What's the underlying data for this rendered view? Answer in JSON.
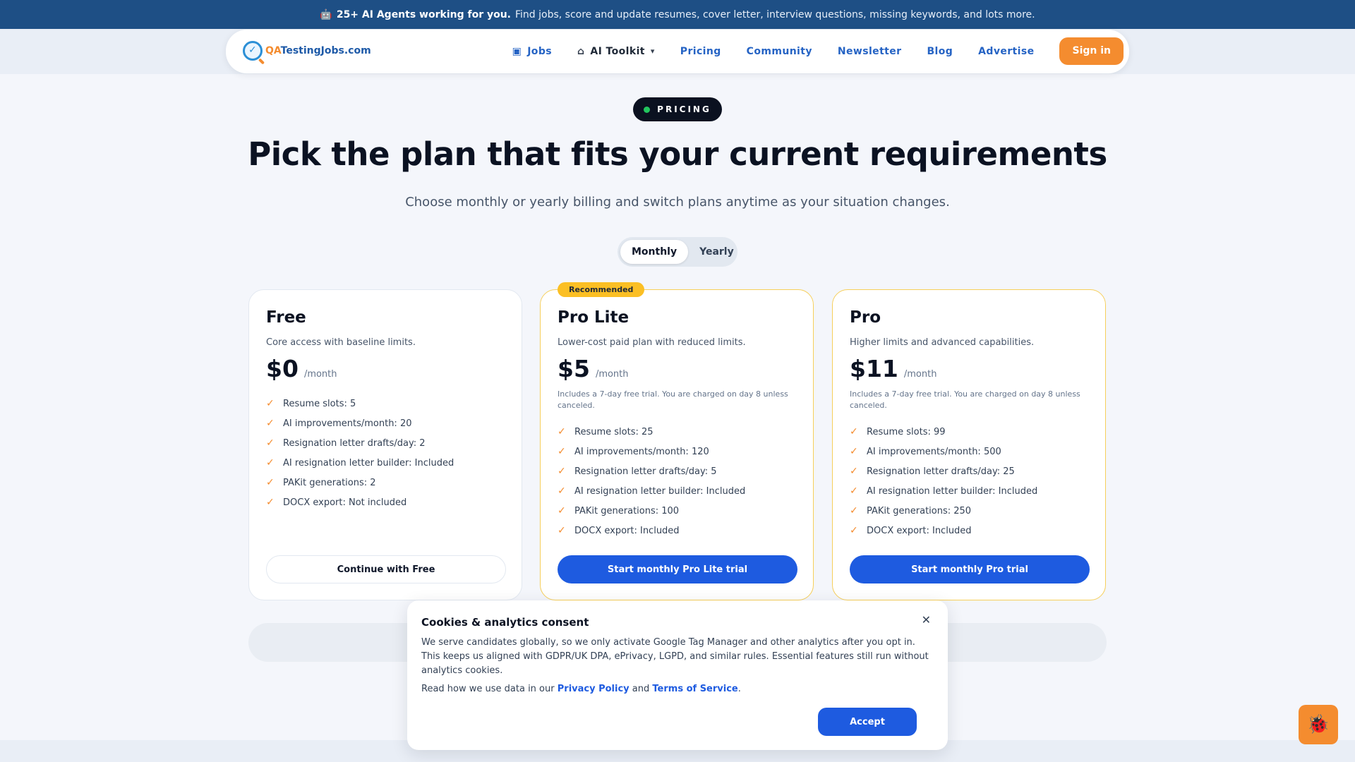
{
  "banner": {
    "robot_icon": "robot-icon",
    "bold": "25+ AI Agents working for you.",
    "text": "Find jobs, score and update resumes, cover letter, interview questions, missing keywords, and lots more."
  },
  "header": {
    "logo_prefix": "QA",
    "logo_text": "TestingJobs.com",
    "nav": {
      "jobs": "Jobs",
      "ai_toolkit": "AI Toolkit",
      "pricing": "Pricing",
      "community": "Community",
      "newsletter": "Newsletter",
      "blog": "Blog",
      "advertise": "Advertise",
      "sign_in": "Sign in"
    }
  },
  "hero": {
    "pill": "PRICING",
    "title": "Pick the plan that fits your current requirements",
    "subtitle": "Choose monthly or yearly billing and switch plans anytime as your situation changes.",
    "toggle": {
      "monthly": "Monthly",
      "yearly": "Yearly",
      "selected": "Monthly"
    }
  },
  "plans": [
    {
      "name": "Free",
      "description": "Core access with baseline limits.",
      "price": "$0",
      "period": "/month",
      "trial_note": "",
      "features": [
        "Resume slots: 5",
        "AI improvements/month: 20",
        "Resignation letter drafts/day: 2",
        "AI resignation letter builder: Included",
        "PAKit generations: 2",
        "DOCX export: Not included"
      ],
      "cta": "Continue with Free"
    },
    {
      "name": "Pro Lite",
      "badge": "Recommended",
      "description": "Lower-cost paid plan with reduced limits.",
      "price": "$5",
      "period": "/month",
      "trial_note": "Includes a 7-day free trial. You are charged on day 8 unless canceled.",
      "features": [
        "Resume slots: 25",
        "AI improvements/month: 120",
        "Resignation letter drafts/day: 5",
        "AI resignation letter builder: Included",
        "PAKit generations: 100",
        "DOCX export: Included"
      ],
      "cta": "Start monthly Pro Lite trial"
    },
    {
      "name": "Pro",
      "description": "Higher limits and advanced capabilities.",
      "price": "$11",
      "period": "/month",
      "trial_note": "Includes a 7-day free trial. You are charged on day 8 unless canceled.",
      "features": [
        "Resume slots: 99",
        "AI improvements/month: 500",
        "Resignation letter drafts/day: 25",
        "AI resignation letter builder: Included",
        "PAKit generations: 250",
        "DOCX export: Included"
      ],
      "cta": "Start monthly Pro trial"
    }
  ],
  "cookie": {
    "title": "Cookies & analytics consent",
    "body": "We serve candidates globally, so we only activate Google Tag Manager and other analytics after you opt in. This keeps us aligned with GDPR/UK DPA, ePrivacy, LGPD, and similar rules. Essential features still run without analytics cookies.",
    "links_prefix": "Read how we use data in our",
    "privacy": "Privacy Policy",
    "and": "and",
    "terms": "Terms of Service",
    "suffix": ".",
    "accept": "Accept",
    "close_icon": "close-icon"
  },
  "floating": {
    "bug_icon": "bug-icon"
  },
  "colors": {
    "banner": "#1e4f85",
    "accent_orange": "#f48c2f",
    "primary_blue": "#1e5be0",
    "badge_yellow": "#fbbf24"
  }
}
